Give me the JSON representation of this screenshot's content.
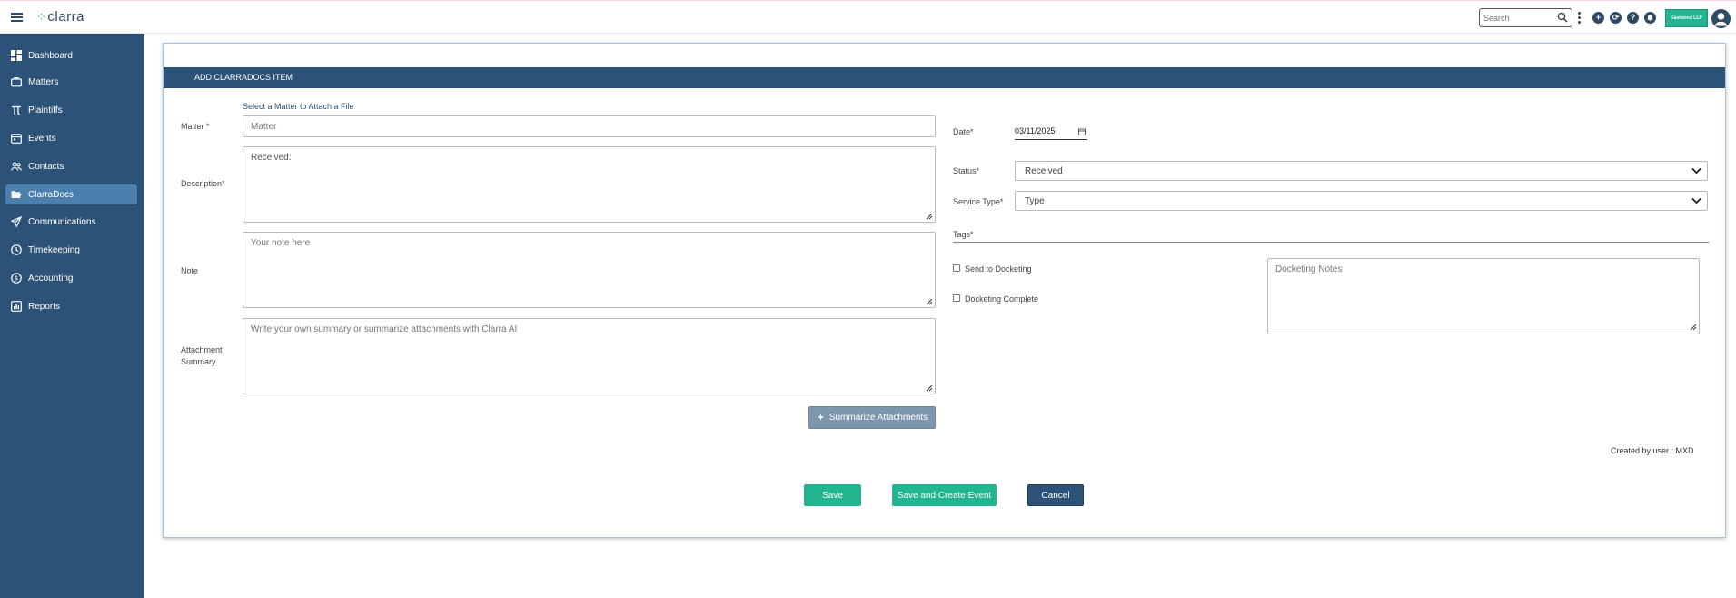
{
  "app": {
    "logo": "clarra",
    "search_placeholder": "Search",
    "firm_badge": "Eastwood LLP"
  },
  "sidebar": {
    "items": [
      {
        "label": "Dashboard",
        "icon": "dashboard-icon"
      },
      {
        "label": "Matters",
        "icon": "briefcase-icon"
      },
      {
        "label": "Plaintiffs",
        "icon": "pi-icon"
      },
      {
        "label": "Events",
        "icon": "calendar-icon"
      },
      {
        "label": "Contacts",
        "icon": "people-icon"
      },
      {
        "label": "ClarraDocs",
        "icon": "folder-open-icon",
        "active": true
      },
      {
        "label": "Communications",
        "icon": "paper-plane-icon"
      },
      {
        "label": "Timekeeping",
        "icon": "clock-icon"
      },
      {
        "label": "Accounting",
        "icon": "dollar-circle-icon"
      },
      {
        "label": "Reports",
        "icon": "report-icon"
      }
    ]
  },
  "form": {
    "header": "ADD CLARRADOCS ITEM",
    "matter_hint": "Select a Matter to Attach a File",
    "matter_label": "Matter *",
    "matter_placeholder": "Matter",
    "description_label": "Description*",
    "description_value": "Received:",
    "note_label": "Note",
    "note_placeholder": "Your note here",
    "attachment_label_1": "Attachment",
    "attachment_label_2": "Summary",
    "attachment_placeholder": "Write your own summary or summarize attachments with Clarra AI",
    "summarize_button": "Summarize Attachments",
    "date_label": "Date*",
    "date_value": "03/11/2025",
    "status_label": "Status*",
    "status_value": "Received",
    "service_type_label": "Service Type*",
    "service_type_value": "Type",
    "tags_label": "Tags*",
    "send_to_docketing": "Send to Docketing",
    "docketing_complete": "Docketing Complete",
    "docketing_notes_placeholder": "Docketing Notes",
    "created_by": "Created by user : MXD",
    "save": "Save",
    "save_and_create_event": "Save and Create Event",
    "cancel": "Cancel"
  },
  "colors": {
    "navy": "#2c5278",
    "green": "#22b58f",
    "active_nav": "#4a7fae"
  }
}
